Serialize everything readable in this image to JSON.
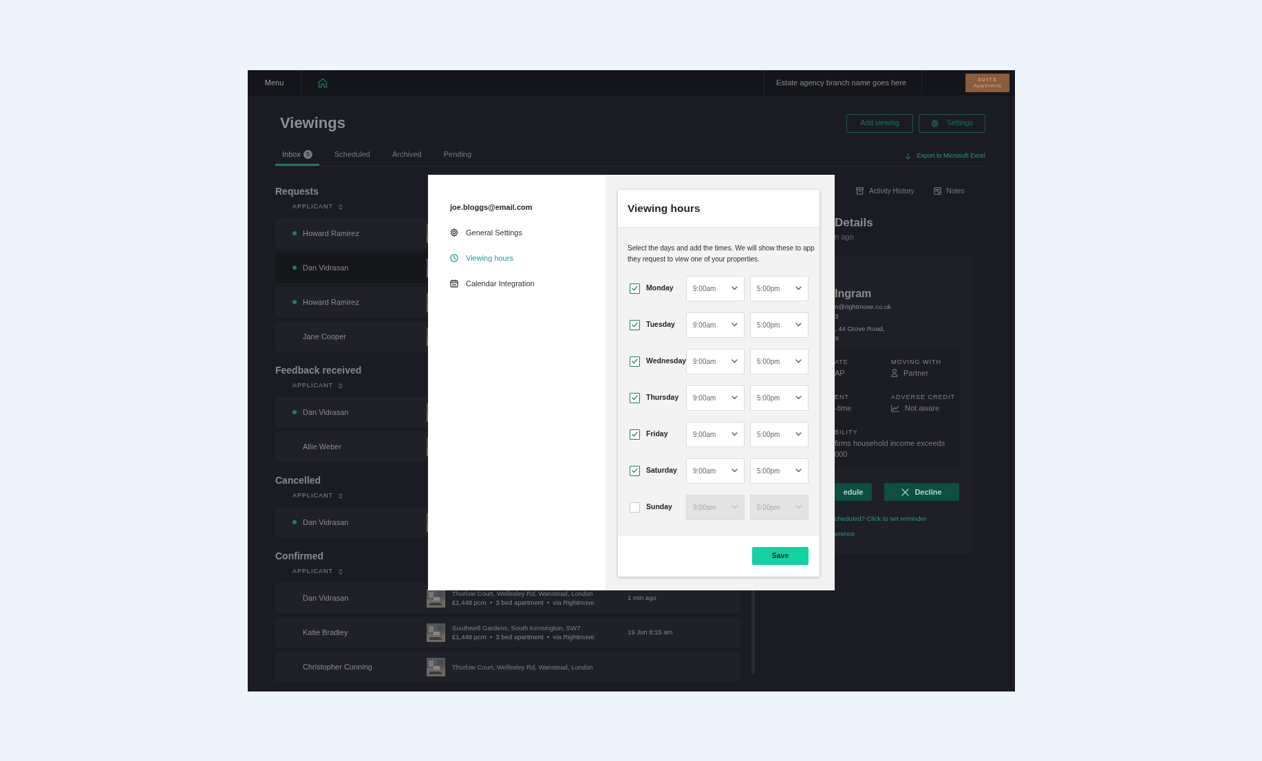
{
  "topbar": {
    "menu": "Menu",
    "branch": "Estate agency branch name goes here",
    "logo": {
      "line1": "SUITS",
      "line2": "Apartments"
    }
  },
  "page": {
    "title": "Viewings",
    "actions": [
      {
        "label": "Add viewing",
        "kind": "plain"
      },
      {
        "label": "Settings",
        "kind": "gear"
      }
    ],
    "export": "Export to Microsoft Excel"
  },
  "tabs": [
    {
      "label": "Inbox",
      "count": "5",
      "selected": true
    },
    {
      "label": "Scheduled",
      "selected": false
    },
    {
      "label": "Archived",
      "selected": false
    },
    {
      "label": "Pending",
      "selected": false
    }
  ],
  "sections": [
    {
      "title": "Requests",
      "column": "APPLICANT",
      "rows": [
        {
          "name": "Howard Ramirez",
          "unread": true,
          "selected": false
        },
        {
          "name": "Dan Vidrasan",
          "unread": true,
          "selected": true
        },
        {
          "name": "Howard Ramirez",
          "unread": true,
          "selected": false
        },
        {
          "name": "Jane Cooper",
          "unread": false,
          "selected": false
        }
      ]
    },
    {
      "title": "Feedback received",
      "column": "APPLICANT",
      "rows": [
        {
          "name": "Dan Vidrasan",
          "unread": true,
          "selected": false
        },
        {
          "name": "Allie Weber",
          "unread": false,
          "selected": false
        }
      ]
    },
    {
      "title": "Cancelled",
      "column": "APPLICANT",
      "rows": [
        {
          "name": "Dan Vidrasan",
          "unread": true,
          "selected": false
        }
      ]
    },
    {
      "title": "Confirmed",
      "column": "APPLICANT",
      "rows": [
        {
          "name": "Dan Vidrasan",
          "unread": false,
          "selected": false,
          "address": "Thurlow Court, Wellesley Rd, Wanstead, London",
          "details": "£1,448 pcm  •  3 bed apartment  •  via Rightmove",
          "time": "1 min ago"
        },
        {
          "name": "Katie Bradley",
          "unread": false,
          "selected": false,
          "address": "Southwell Gardens, South Kensington, SW7",
          "details": "£1,448 pcm  •  3 bed apartment  •  via Rightmove",
          "time": "19 Jun 8:15 am"
        },
        {
          "name": "Christopher Cunning",
          "unread": false,
          "selected": false,
          "address": "Thurlow Court, Wellesley Rd, Wanstead, London"
        }
      ]
    }
  ],
  "detail": {
    "tabs": [
      {
        "label": "Activity History",
        "kind": "archive"
      },
      {
        "label": "Notes",
        "kind": "note"
      }
    ],
    "title": "Details",
    "subtitle": "n ago",
    "name": "Ingram",
    "contact": [
      "n@rightmove.co.uk",
      "3",
      ", 44 Grove Road,",
      "X"
    ],
    "facts": [
      {
        "label": "ATE",
        "value": "AP"
      },
      {
        "label": "MOVING WITH",
        "value": "Partner",
        "kind": "person"
      },
      {
        "label": "ENT",
        "value": "-time"
      },
      {
        "label": "ADVERSE CREDIT",
        "value": "Not aware",
        "kind": "chart"
      },
      {
        "label": "BILITY",
        "value": "firms household income exceeds\n000"
      }
    ],
    "buttons": [
      {
        "label": "edule",
        "kind": "plain"
      },
      {
        "label": "Decline",
        "kind": "cross"
      }
    ],
    "links": [
      "cheduled? Click to set reminder",
      "erence"
    ]
  },
  "modal": {
    "account": "joe.bloggs@email.com",
    "menu": [
      {
        "label": "General Settings",
        "kind": "gear",
        "selected": false
      },
      {
        "label": "Viewing hours",
        "kind": "clock",
        "selected": true
      },
      {
        "label": "Calendar Integration",
        "kind": "calendar",
        "selected": false
      }
    ],
    "title": "Viewing hours",
    "description": "Select the days and add the times. We will show these to app\nthey request to view one of your properties.",
    "days": [
      {
        "day": "Monday",
        "checked": true,
        "from": "9:00am",
        "to": "5:00pm"
      },
      {
        "day": "Tuesday",
        "checked": true,
        "from": "9:00am",
        "to": "5:00pm"
      },
      {
        "day": "Wednesday",
        "checked": true,
        "from": "9:00am",
        "to": "5:00pm"
      },
      {
        "day": "Thursday",
        "checked": true,
        "from": "9:00am",
        "to": "5:00pm"
      },
      {
        "day": "Friday",
        "checked": true,
        "from": "9:00am",
        "to": "5:00pm"
      },
      {
        "day": "Saturday",
        "checked": true,
        "from": "9:00am",
        "to": "5:00pm"
      },
      {
        "day": "Sunday",
        "checked": false,
        "from": "9:00am",
        "to": "5:00pm"
      }
    ],
    "save": "Save"
  }
}
